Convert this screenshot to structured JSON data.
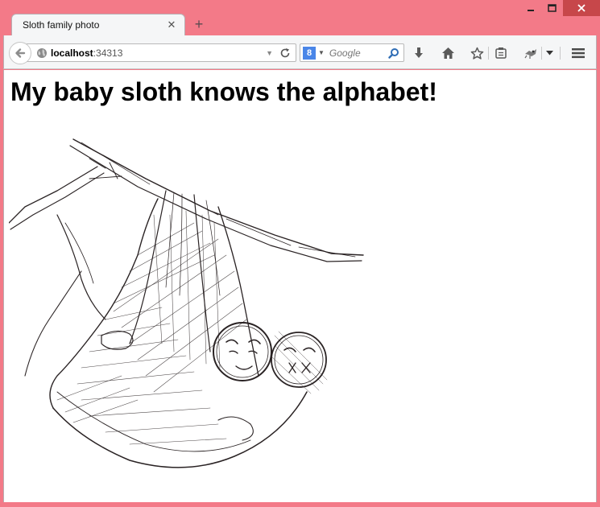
{
  "browser": {
    "tab_title": "Sloth family photo",
    "tab_close_glyph": "✕",
    "new_tab_glyph": "+",
    "url_host": "localhost",
    "url_port": ":34313",
    "search_placeholder": "Google",
    "search_engine_letter": "8"
  },
  "page": {
    "heading": "My baby sloth knows the alphabet!"
  },
  "icons": [
    "minimize-icon",
    "maximize-icon",
    "close-icon",
    "back-arrow-icon",
    "globe-icon",
    "dropdown-icon",
    "reload-icon",
    "google-icon",
    "search-icon",
    "download-icon",
    "home-icon",
    "bookmark-star-icon",
    "reading-list-icon",
    "addon-icon",
    "menu-icon"
  ],
  "colors": {
    "window_frame": "#f37a88",
    "close_button": "#c7474a",
    "toolbar": "#f5f6f7"
  }
}
